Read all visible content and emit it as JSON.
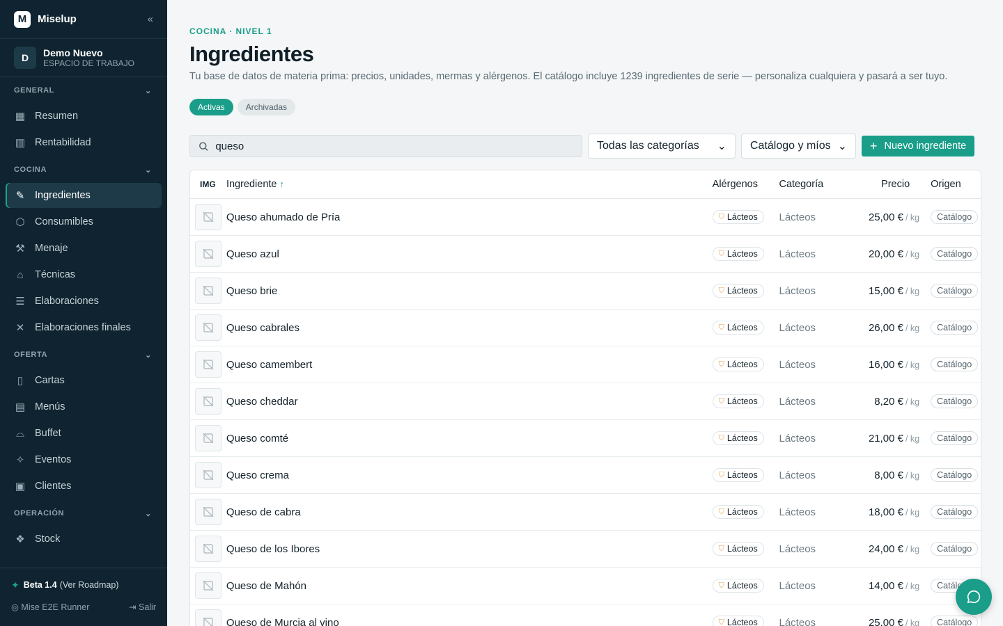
{
  "app": {
    "name": "Miselup",
    "logo_letter": "M"
  },
  "workspace": {
    "avatar": "D",
    "name": "Demo Nuevo",
    "type": "ESPACIO DE TRABAJO"
  },
  "sidebar": {
    "sections": [
      {
        "title": "GENERAL",
        "items": [
          {
            "label": "Resumen",
            "icon": "dashboard-icon"
          },
          {
            "label": "Rentabilidad",
            "icon": "bar-chart-icon"
          }
        ]
      },
      {
        "title": "COCINA",
        "items": [
          {
            "label": "Ingredientes",
            "icon": "carrot-icon",
            "active": true
          },
          {
            "label": "Consumibles",
            "icon": "box-icon"
          },
          {
            "label": "Menaje",
            "icon": "utensil-icon"
          },
          {
            "label": "Técnicas",
            "icon": "graduation-cap-icon"
          },
          {
            "label": "Elaboraciones",
            "icon": "pot-icon"
          },
          {
            "label": "Elaboraciones finales",
            "icon": "cutlery-icon"
          }
        ]
      },
      {
        "title": "OFERTA",
        "items": [
          {
            "label": "Cartas",
            "icon": "book-icon"
          },
          {
            "label": "Menús",
            "icon": "clipboard-icon"
          },
          {
            "label": "Buffet",
            "icon": "cloche-icon"
          },
          {
            "label": "Eventos",
            "icon": "party-icon"
          },
          {
            "label": "Clientes",
            "icon": "contact-icon"
          }
        ]
      },
      {
        "title": "OPERACIÓN",
        "items": [
          {
            "label": "Stock",
            "icon": "boxes-icon"
          }
        ]
      }
    ],
    "footer": {
      "beta_label": "Beta 1.4",
      "roadmap": "(Ver Roadmap)",
      "user": "Mise E2E Runner",
      "logout": "Salir"
    }
  },
  "page": {
    "breadcrumb": "COCINA · NIVEL 1",
    "title": "Ingredientes",
    "subtitle": "Tu base de datos de materia prima: precios, unidades, mermas y alérgenos. El catálogo incluye 1239 ingredientes de serie — personaliza cualquiera y pasará a ser tuyo.",
    "tabs": [
      "Activas",
      "Archivadas"
    ],
    "active_tab": "Activas",
    "search": {
      "value": "queso"
    },
    "filters": {
      "category": "Todas las categorías",
      "source": "Catálogo y míos"
    },
    "new_button": "Nuevo ingrediente"
  },
  "table": {
    "columns": {
      "img": "IMG",
      "name": "Ingrediente",
      "allergens": "Alérgenos",
      "category": "Categoría",
      "price": "Precio",
      "origin": "Origen"
    },
    "rows": [
      {
        "name": "Queso ahumado de Pría",
        "allergen": "Lácteos",
        "category": "Lácteos",
        "price": "25,00 €",
        "unit": "/ kg",
        "origin": "Catálogo"
      },
      {
        "name": "Queso azul",
        "allergen": "Lácteos",
        "category": "Lácteos",
        "price": "20,00 €",
        "unit": "/ kg",
        "origin": "Catálogo"
      },
      {
        "name": "Queso brie",
        "allergen": "Lácteos",
        "category": "Lácteos",
        "price": "15,00 €",
        "unit": "/ kg",
        "origin": "Catálogo"
      },
      {
        "name": "Queso cabrales",
        "allergen": "Lácteos",
        "category": "Lácteos",
        "price": "26,00 €",
        "unit": "/ kg",
        "origin": "Catálogo"
      },
      {
        "name": "Queso camembert",
        "allergen": "Lácteos",
        "category": "Lácteos",
        "price": "16,00 €",
        "unit": "/ kg",
        "origin": "Catálogo"
      },
      {
        "name": "Queso cheddar",
        "allergen": "Lácteos",
        "category": "Lácteos",
        "price": "8,20 €",
        "unit": "/ kg",
        "origin": "Catálogo"
      },
      {
        "name": "Queso comté",
        "allergen": "Lácteos",
        "category": "Lácteos",
        "price": "21,00 €",
        "unit": "/ kg",
        "origin": "Catálogo"
      },
      {
        "name": "Queso crema",
        "allergen": "Lácteos",
        "category": "Lácteos",
        "price": "8,00 €",
        "unit": "/ kg",
        "origin": "Catálogo"
      },
      {
        "name": "Queso de cabra",
        "allergen": "Lácteos",
        "category": "Lácteos",
        "price": "18,00 €",
        "unit": "/ kg",
        "origin": "Catálogo"
      },
      {
        "name": "Queso de los Ibores",
        "allergen": "Lácteos",
        "category": "Lácteos",
        "price": "24,00 €",
        "unit": "/ kg",
        "origin": "Catálogo"
      },
      {
        "name": "Queso de Mahón",
        "allergen": "Lácteos",
        "category": "Lácteos",
        "price": "14,00 €",
        "unit": "/ kg",
        "origin": "Catálogo"
      },
      {
        "name": "Queso de Murcia al vino",
        "allergen": "Lácteos",
        "category": "Lácteos",
        "price": "25,00 €",
        "unit": "/ kg",
        "origin": "Catálogo"
      }
    ]
  },
  "colors": {
    "accent": "#1a9e8a",
    "sidebar_bg": "#0f2430",
    "allergen_icon": "#e3a14b"
  }
}
